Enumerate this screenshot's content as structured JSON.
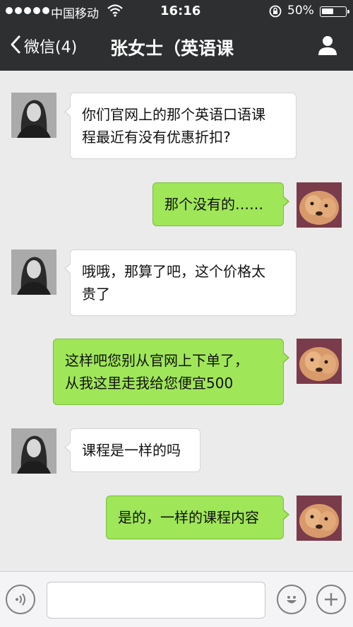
{
  "status_bar": {
    "carrier": "中国移动",
    "time": "16:16",
    "battery_percent": "50%",
    "battery_level": 0.5,
    "icons": [
      "signal-dots-icon",
      "wifi-icon",
      "rotation-lock-icon",
      "battery-icon"
    ]
  },
  "nav": {
    "back_label": "微信(4)",
    "title": "张女士（英语课",
    "icons": [
      "chevron-left-icon",
      "profile-icon"
    ]
  },
  "messages": [
    {
      "from": "other",
      "text_lines": [
        "你们官网上的那个英语口语课",
        "程最近有没有优惠折扣?"
      ]
    },
    {
      "from": "me",
      "text_lines": [
        "那个没有的……"
      ]
    },
    {
      "from": "other",
      "text_lines": [
        "哦哦，那算了吧，这个价格太",
        "贵了"
      ]
    },
    {
      "from": "me",
      "text_lines": [
        "这样吧您别从官网上下单了，",
        "从我这里走我给您便宜500"
      ]
    },
    {
      "from": "other",
      "text_lines": [
        "课程是一样的吗"
      ]
    },
    {
      "from": "me",
      "text_lines": [
        "是的，一样的课程内容"
      ]
    }
  ],
  "input_bar": {
    "placeholder": "",
    "icons": [
      "voice-icon",
      "emoji-icon",
      "plus-icon"
    ]
  },
  "colors": {
    "bar_background": "#2d2f31",
    "chat_background": "#ebebeb",
    "outgoing_bubble": "#9fe658",
    "incoming_bubble": "#ffffff"
  }
}
